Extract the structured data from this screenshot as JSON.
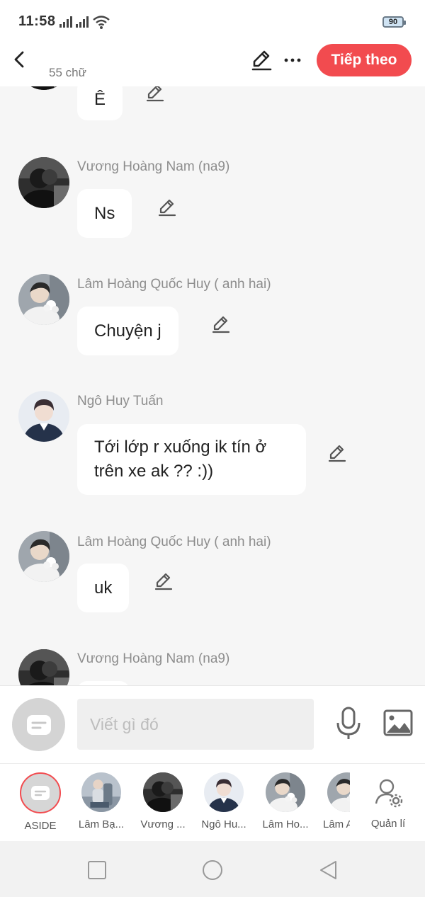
{
  "status_bar": {
    "time": "11:58",
    "battery": "90",
    "icons": [
      "signal-icon",
      "signal-icon",
      "wifi-icon",
      "battery-icon"
    ]
  },
  "top_bar": {
    "word_count": "55 chữ",
    "next_label": "Tiếp theo",
    "icons": [
      "back-arrow-icon",
      "pen-icon",
      "more-icon"
    ]
  },
  "messages": [
    {
      "sender": "",
      "text": "Ê"
    },
    {
      "sender": "Vương Hoàng Nam (na9)",
      "text": "Ns"
    },
    {
      "sender": "Lâm Hoàng Quốc Huy ( anh hai)",
      "text": "Chuyện j"
    },
    {
      "sender": "Ngô Huy Tuấn",
      "text_line1": "Tới lớp r xuống ik tín ở",
      "text_line2": "trên xe ak ?? :))"
    },
    {
      "sender": "Lâm Hoàng Quốc Huy ( anh hai)",
      "text": "uk"
    },
    {
      "sender": "Vương Hoàng Nam (na9)",
      "text": ""
    }
  ],
  "composer": {
    "placeholder": "Viết gì đó",
    "icons": [
      "aside-icon",
      "mic-icon",
      "image-icon"
    ]
  },
  "characters": [
    {
      "name": "ASIDE"
    },
    {
      "name": "Lâm Bạ..."
    },
    {
      "name": "Vương ..."
    },
    {
      "name": "Ngô Hu..."
    },
    {
      "name": "Lâm Ho..."
    },
    {
      "name": "Lâm A"
    },
    {
      "name": "Quản lí"
    }
  ],
  "nav": {
    "icons": [
      "recent-apps-icon",
      "home-icon",
      "back-icon"
    ]
  },
  "colors": {
    "accent": "#f24b4f",
    "background": "#f6f6f6",
    "bubble": "#ffffff",
    "sender_text": "#8d8d8d"
  }
}
